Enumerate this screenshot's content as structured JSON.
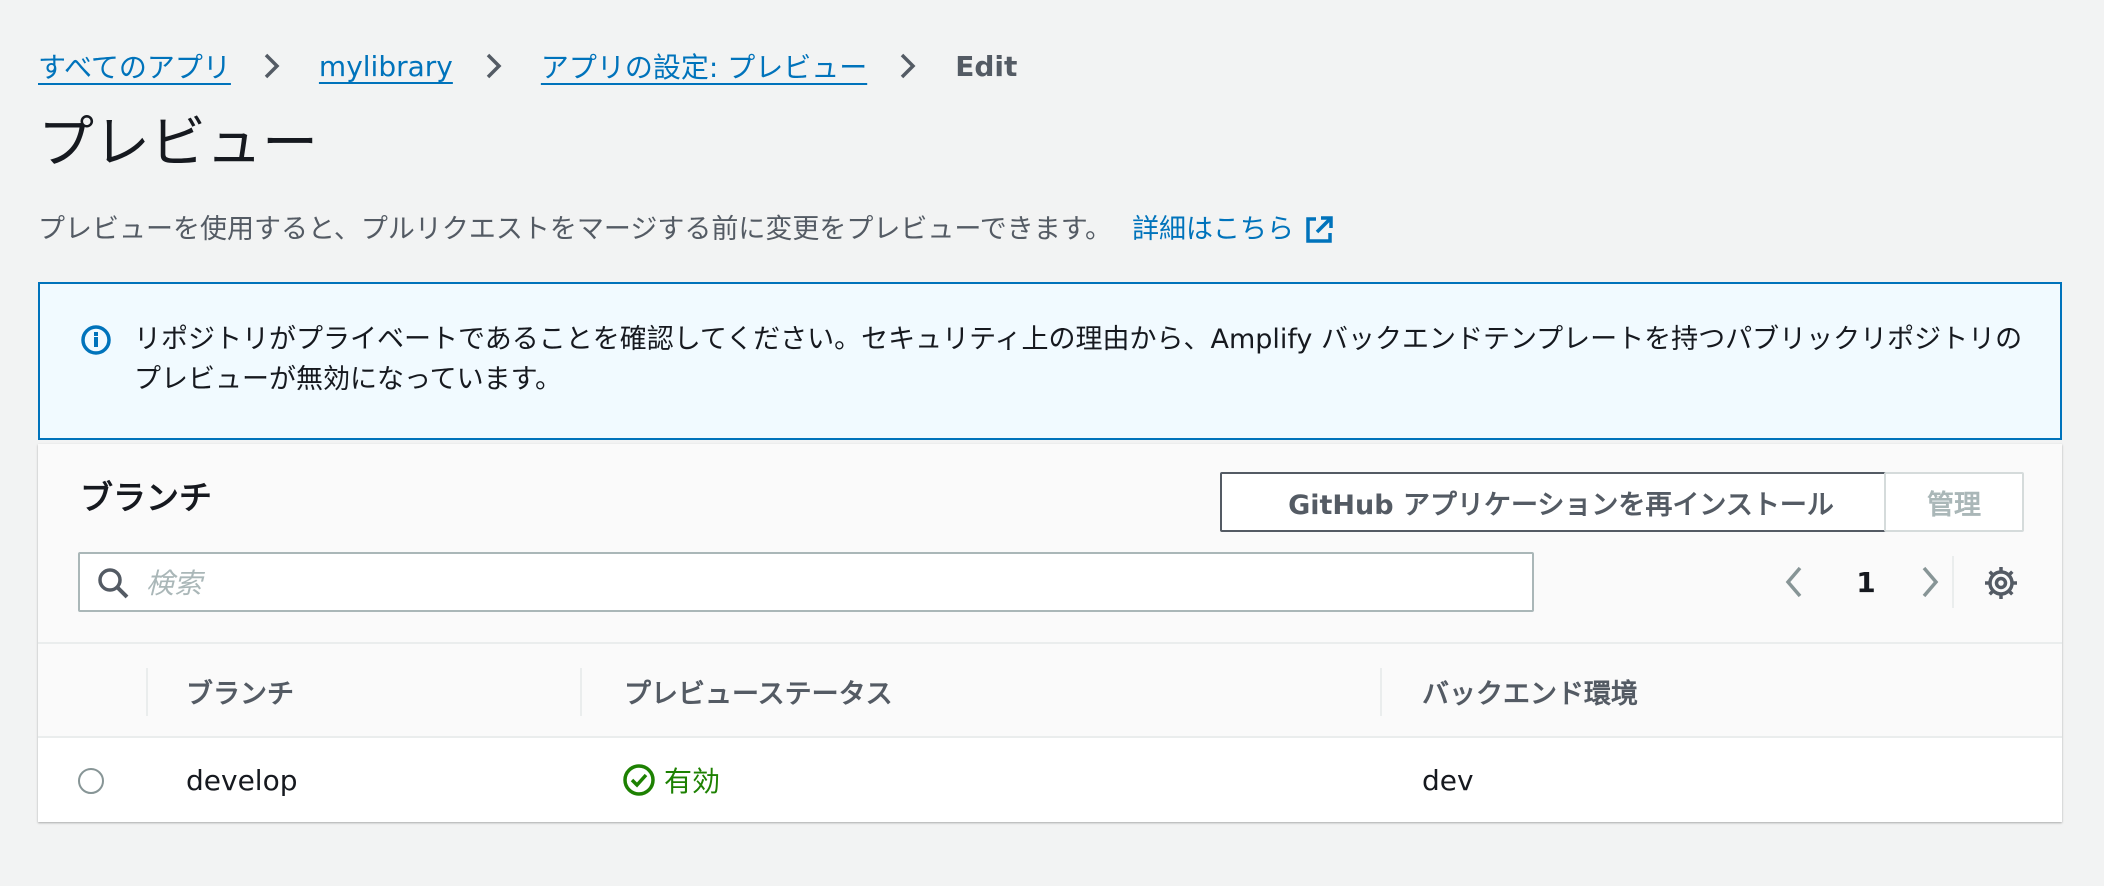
{
  "breadcrumb": {
    "items": [
      {
        "label": "すべてのアプリ"
      },
      {
        "label": "mylibrary"
      },
      {
        "label": "アプリの設定: プレビュー"
      }
    ],
    "current": "Edit"
  },
  "page": {
    "title": "プレビュー",
    "description": "プレビューを使用すると、プルリクエストをマージする前に変更をプレビューできます。",
    "learn_more": "詳細はこちら"
  },
  "alert": {
    "text": "リポジトリがプライベートであることを確認してください。セキュリティ上の理由から、Amplify バックエンドテンプレートを持つパブリックリポジトリのプレビューが無効になっています。"
  },
  "branches_panel": {
    "title": "ブランチ",
    "reinstall_button": "GitHub アプリケーションを再インストール",
    "manage_button": "管理",
    "search_placeholder": "検索",
    "current_page": "1"
  },
  "table": {
    "columns": [
      "ブランチ",
      "プレビューステータス",
      "バックエンド環境"
    ],
    "rows": [
      {
        "branch": "develop",
        "status": "有効",
        "backend": "dev"
      }
    ]
  },
  "colors": {
    "link": "#0073bb",
    "success": "#1d8102",
    "alert_border": "#0073bb",
    "alert_bg": "#f1faff"
  },
  "icons": [
    "chevron-right-icon",
    "external-link-icon",
    "info-icon",
    "search-icon",
    "chevron-left-icon",
    "settings-gear-icon",
    "check-circle-icon"
  ]
}
